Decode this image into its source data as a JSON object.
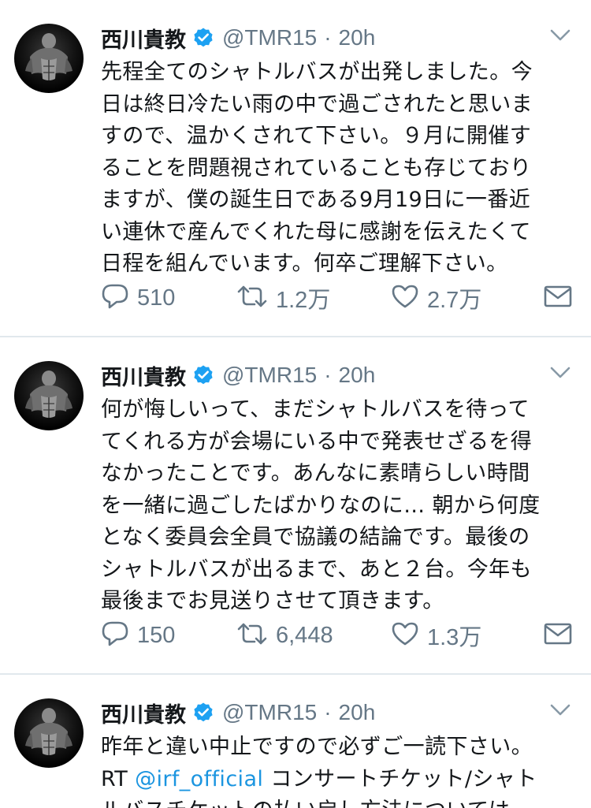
{
  "tweets": [
    {
      "author_name": "西川貴教",
      "handle": "@TMR15",
      "separator": "·",
      "time": "20h",
      "lines": [
        "先程全てのシャトルバスが出発しました。今",
        "日は終日冷たい雨の中で過ごされたと思いま",
        "すので、温かくされて下さい。９月に開催す",
        "ることを問題視されていることも存じており",
        "ますが、僕の誕生日である9月19日に一番近",
        "い連休で産んでくれた母に感謝を伝えたくて",
        "日程を組んでいます。何卒ご理解下さい。"
      ],
      "replies": "510",
      "retweets": "1.2万",
      "likes": "2.7万"
    },
    {
      "author_name": "西川貴教",
      "handle": "@TMR15",
      "separator": "·",
      "time": "20h",
      "lines": [
        "何が悔しいって、まだシャトルバスを待って",
        "てくれる方が会場にいる中で発表せざるを得",
        "なかったことです。あんなに素晴らしい時間",
        "を一緒に過ごしたばかりなのに… 朝から何度",
        "となく委員会全員で協議の結論です。最後の",
        "シャトルバスが出るまで、あと２台。今年も",
        "最後までお見送りさせて頂きます。"
      ],
      "replies": "150",
      "retweets": "6,448",
      "likes": "1.3万"
    },
    {
      "author_name": "西川貴教",
      "handle": "@TMR15",
      "separator": "·",
      "time": "20h",
      "line1": "昨年と違い中止ですので必ずご一読下さい。",
      "rt_prefix": "RT ",
      "mention": "@irf_official",
      "line2_rest": " コンサートチケット/シャト",
      "line3": "ルバスチケットの払い戻し方法については"
    }
  ],
  "colors": {
    "text": "#14171a",
    "secondary": "#657786",
    "link": "#1b95e0",
    "verified": "#1da1f2",
    "divider": "#e1e8ed"
  },
  "icons": {
    "reply": "reply-icon",
    "retweet": "retweet-icon",
    "like": "heart-icon",
    "dm": "envelope-icon",
    "menu": "chevron-down-icon",
    "verified": "verified-badge-icon"
  }
}
